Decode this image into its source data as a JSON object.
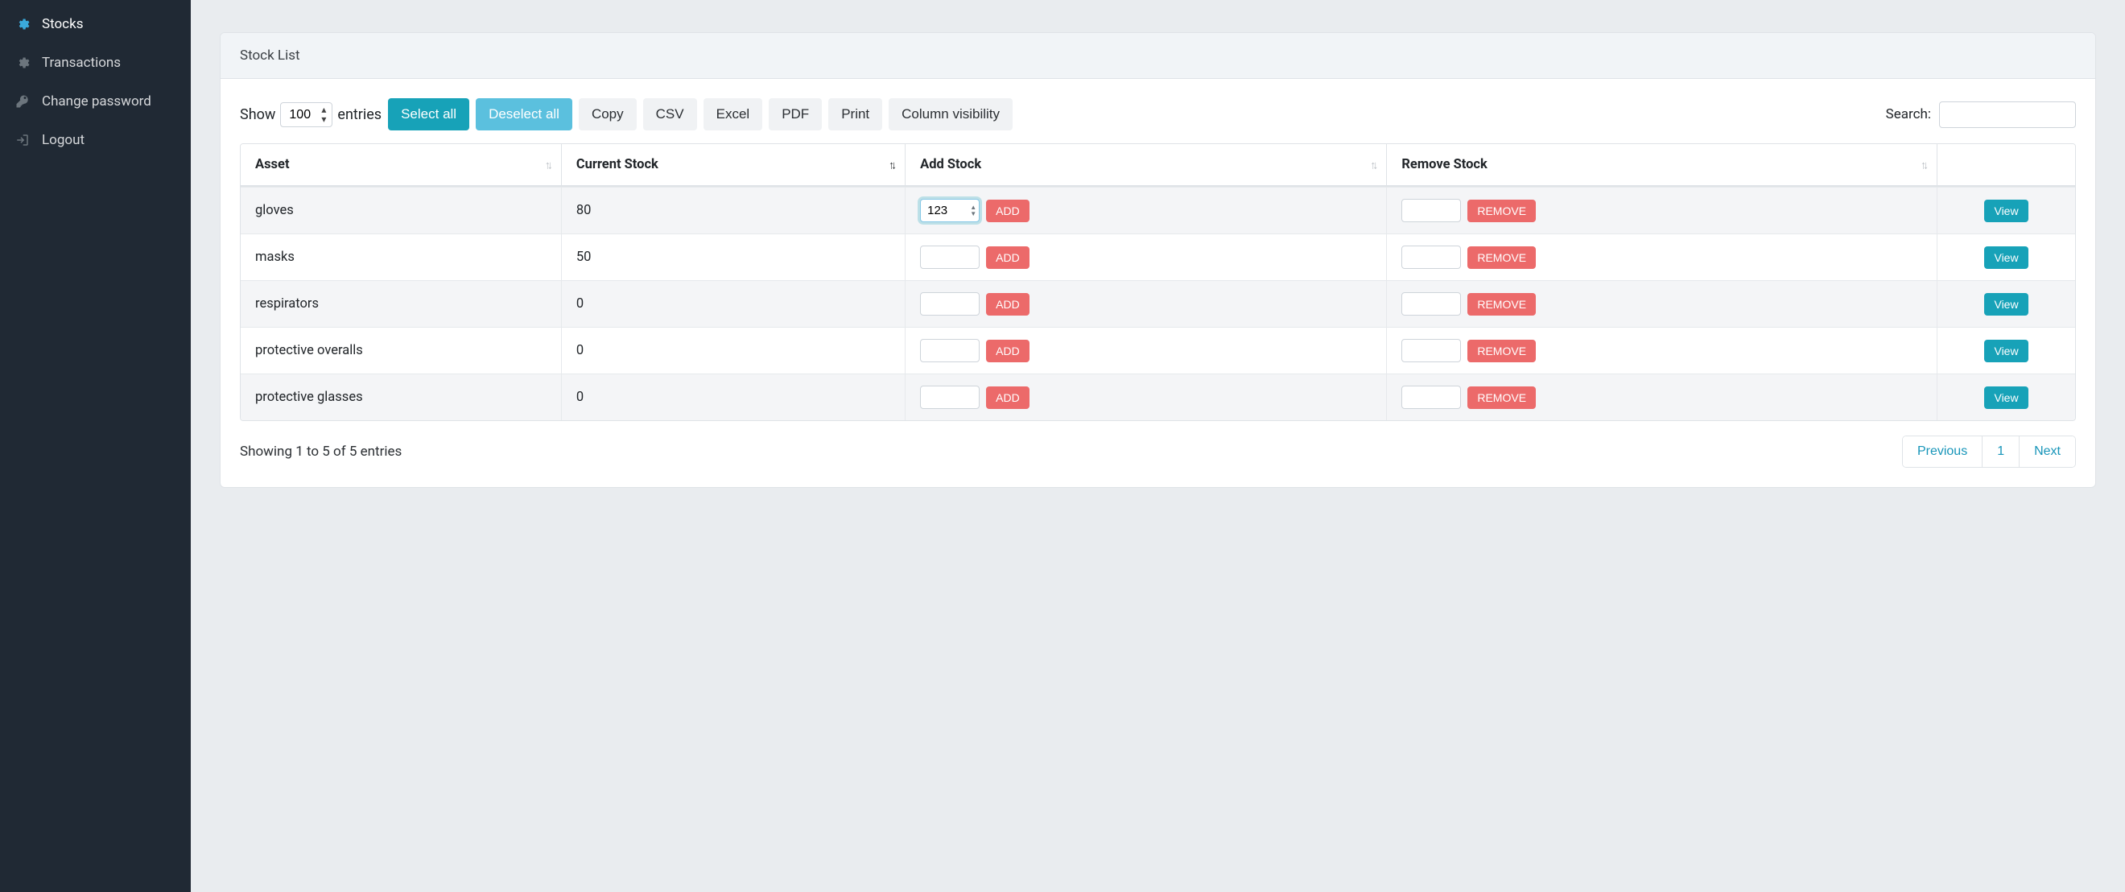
{
  "sidebar": {
    "items": [
      {
        "label": "Stocks",
        "icon": "cogs",
        "active": true
      },
      {
        "label": "Transactions",
        "icon": "cogs",
        "active": false
      },
      {
        "label": "Change password",
        "icon": "key",
        "active": false
      },
      {
        "label": "Logout",
        "icon": "logout",
        "active": false
      }
    ]
  },
  "card": {
    "title": "Stock List"
  },
  "length": {
    "show_label": "Show",
    "entries_label": "entries",
    "selected": "100"
  },
  "toolbar": {
    "select_all": "Select all",
    "deselect_all": "Deselect all",
    "copy": "Copy",
    "csv": "CSV",
    "excel": "Excel",
    "pdf": "PDF",
    "print": "Print",
    "colvis": "Column visibility"
  },
  "search": {
    "label": "Search:",
    "value": ""
  },
  "columns": {
    "asset": "Asset",
    "current_stock": "Current Stock",
    "add_stock": "Add Stock",
    "remove_stock": "Remove Stock"
  },
  "buttons": {
    "add": "ADD",
    "remove": "REMOVE",
    "view": "View"
  },
  "rows": [
    {
      "asset": "gloves",
      "current_stock": "80",
      "add_value": "123",
      "remove_value": "",
      "focused": true
    },
    {
      "asset": "masks",
      "current_stock": "50",
      "add_value": "",
      "remove_value": "",
      "focused": false
    },
    {
      "asset": "respirators",
      "current_stock": "0",
      "add_value": "",
      "remove_value": "",
      "focused": false
    },
    {
      "asset": "protective overalls",
      "current_stock": "0",
      "add_value": "",
      "remove_value": "",
      "focused": false
    },
    {
      "asset": "protective glasses",
      "current_stock": "0",
      "add_value": "",
      "remove_value": "",
      "focused": false
    }
  ],
  "footer": {
    "info": "Showing 1 to 5 of 5 entries",
    "previous": "Previous",
    "page": "1",
    "next": "Next"
  }
}
